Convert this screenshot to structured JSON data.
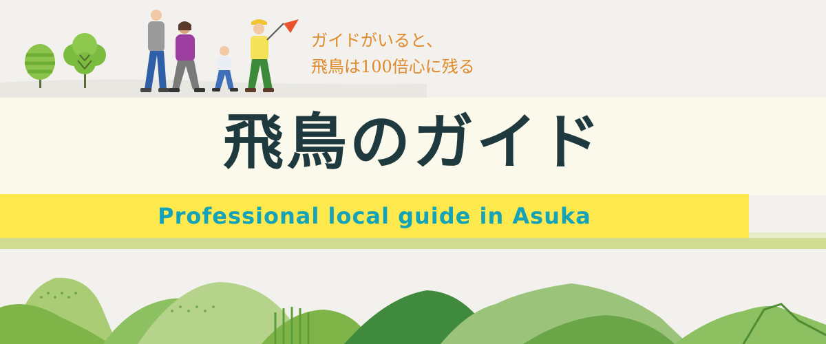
{
  "banner": {
    "tagline_line1": "ガイドがいると、",
    "tagline_line2": "飛鳥は100倍心に残る",
    "title": "飛鳥のガイド",
    "subtitle": "Professional local guide in Asuka"
  },
  "illustration": {
    "trees": [
      "tree-icon",
      "tree-icon"
    ],
    "people": [
      "man-walking-icon",
      "woman-walking-icon",
      "child-walking-icon",
      "guide-with-flag-icon"
    ],
    "landscape": "green-mountains-illustration"
  },
  "colors": {
    "title": "#1f3a3f",
    "tagline": "#e08a2a",
    "subtitle": "#14a3b8",
    "band_yellow": "#fde84d",
    "band_cream": "#fbf8ec"
  }
}
